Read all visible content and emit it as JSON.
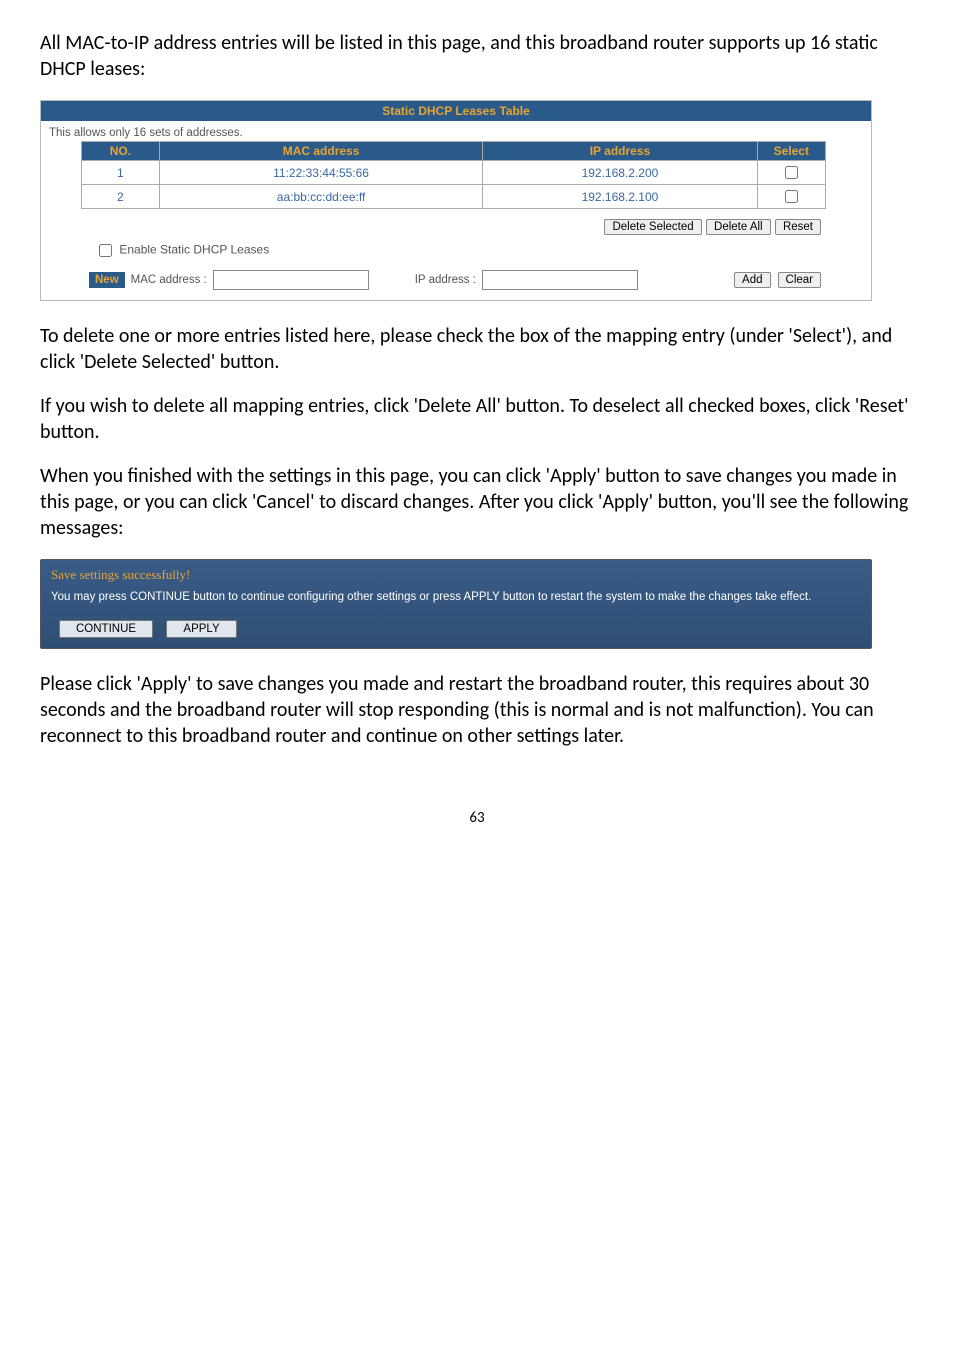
{
  "intro_text": "All MAC-to-IP address entries will be listed in this page, and this broadband router supports up 16 static DHCP leases:",
  "table": {
    "title": "Static DHCP Leases Table",
    "info_line": "This allows only 16 sets of addresses.",
    "headers": {
      "no": "NO.",
      "mac": "MAC address",
      "ip": "IP address",
      "sel": "Select"
    },
    "rows": [
      {
        "no": "1",
        "mac": "11:22:33:44:55:66",
        "ip": "192.168.2.200"
      },
      {
        "no": "2",
        "mac": "aa:bb:cc:dd:ee:ff",
        "ip": "192.168.2.100"
      }
    ],
    "buttons": {
      "del_sel": "Delete Selected",
      "del_all": "Delete All",
      "reset": "Reset"
    },
    "enable_label": "Enable Static DHCP Leases",
    "new_tag": "New",
    "mac_label": "MAC address :",
    "ip_label": "IP address :",
    "add": "Add",
    "clear": "Clear"
  },
  "para2": "To delete one or more entries listed here, please check the box of the mapping entry (under 'Select'), and click 'Delete Selected' button.",
  "para3": "If you wish to delete all mapping entries, click 'Delete All' button. To deselect all checked boxes, click 'Reset' button.",
  "para4": "When you finished with the settings in this page, you can click 'Apply' button to save changes you made in this page, or you can click 'Cancel' to discard changes. After you click 'Apply' button, you'll see the following messages:",
  "bluebox": {
    "heading": "Save settings successfully!",
    "body": "You may press CONTINUE button to continue configuring other settings or press APPLY button to restart the system to make the changes take effect.",
    "continue": "CONTINUE",
    "apply": "APPLY"
  },
  "para5": "Please click 'Apply' to save changes you made and restart the broadband router, this requires about 30 seconds and the broadband router will stop responding (this is normal and is not malfunction). You can reconnect to this broadband router and continue on other settings later.",
  "page_number": "63"
}
